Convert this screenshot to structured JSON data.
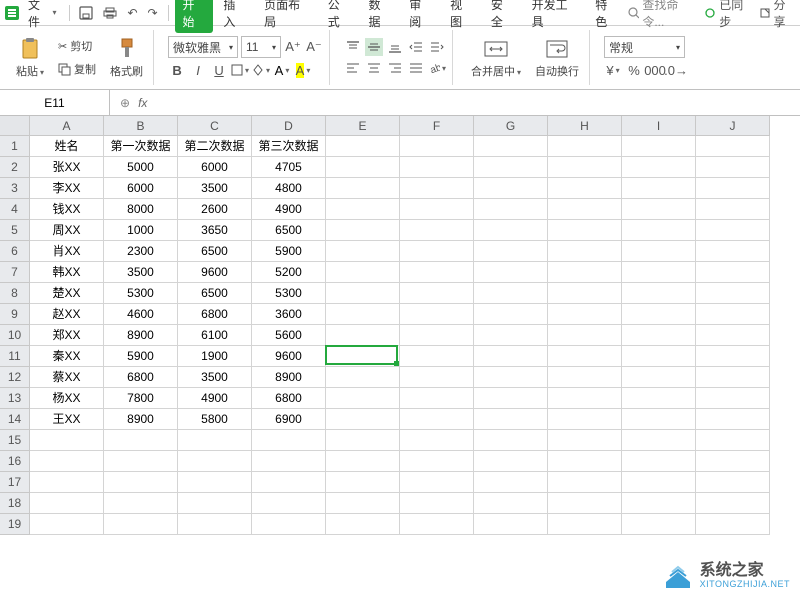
{
  "menu": {
    "file": "文件",
    "tabs": [
      "开始",
      "插入",
      "页面布局",
      "公式",
      "数据",
      "审阅",
      "视图",
      "安全",
      "开发工具",
      "特色"
    ],
    "active_tab": 0,
    "search_placeholder": "查找命令...",
    "sync": "已同步",
    "share": "分享"
  },
  "ribbon": {
    "paste": "粘贴",
    "cut": "剪切",
    "copy": "复制",
    "format_painter": "格式刷",
    "font_name": "微软雅黑",
    "font_size": "11",
    "merge_center": "合并居中",
    "wrap_text": "自动换行",
    "number_format": "常规"
  },
  "formula": {
    "cell_ref": "E11",
    "fx_label": "fx",
    "value": ""
  },
  "columns": [
    "A",
    "B",
    "C",
    "D",
    "E",
    "F",
    "G",
    "H",
    "I",
    "J"
  ],
  "rows": [
    "1",
    "2",
    "3",
    "4",
    "5",
    "6",
    "7",
    "8",
    "9",
    "10",
    "11",
    "12",
    "13",
    "14",
    "15",
    "16",
    "17",
    "18",
    "19"
  ],
  "data": [
    [
      "姓名",
      "第一次数据",
      "第二次数据",
      "第三次数据",
      "",
      "",
      "",
      "",
      "",
      ""
    ],
    [
      "张XX",
      "5000",
      "6000",
      "4705",
      "",
      "",
      "",
      "",
      "",
      ""
    ],
    [
      "李XX",
      "6000",
      "3500",
      "4800",
      "",
      "",
      "",
      "",
      "",
      ""
    ],
    [
      "钱XX",
      "8000",
      "2600",
      "4900",
      "",
      "",
      "",
      "",
      "",
      ""
    ],
    [
      "周XX",
      "1000",
      "3650",
      "6500",
      "",
      "",
      "",
      "",
      "",
      ""
    ],
    [
      "肖XX",
      "2300",
      "6500",
      "5900",
      "",
      "",
      "",
      "",
      "",
      ""
    ],
    [
      "韩XX",
      "3500",
      "9600",
      "5200",
      "",
      "",
      "",
      "",
      "",
      ""
    ],
    [
      "楚XX",
      "5300",
      "6500",
      "5300",
      "",
      "",
      "",
      "",
      "",
      ""
    ],
    [
      "赵XX",
      "4600",
      "6800",
      "3600",
      "",
      "",
      "",
      "",
      "",
      ""
    ],
    [
      "郑XX",
      "8900",
      "6100",
      "5600",
      "",
      "",
      "",
      "",
      "",
      ""
    ],
    [
      "秦XX",
      "5900",
      "1900",
      "9600",
      "",
      "",
      "",
      "",
      "",
      ""
    ],
    [
      "蔡XX",
      "6800",
      "3500",
      "8900",
      "",
      "",
      "",
      "",
      "",
      ""
    ],
    [
      "杨XX",
      "7800",
      "4900",
      "6800",
      "",
      "",
      "",
      "",
      "",
      ""
    ],
    [
      "王XX",
      "8900",
      "5800",
      "6900",
      "",
      "",
      "",
      "",
      "",
      ""
    ],
    [
      "",
      "",
      "",
      "",
      "",
      "",
      "",
      "",
      "",
      ""
    ],
    [
      "",
      "",
      "",
      "",
      "",
      "",
      "",
      "",
      "",
      ""
    ],
    [
      "",
      "",
      "",
      "",
      "",
      "",
      "",
      "",
      "",
      ""
    ],
    [
      "",
      "",
      "",
      "",
      "",
      "",
      "",
      "",
      "",
      ""
    ],
    [
      "",
      "",
      "",
      "",
      "",
      "",
      "",
      "",
      "",
      ""
    ]
  ],
  "selection": {
    "row": 11,
    "col": 5
  },
  "watermark": {
    "cn": "系统之家",
    "en": "XITONGZHIJIA.NET"
  }
}
